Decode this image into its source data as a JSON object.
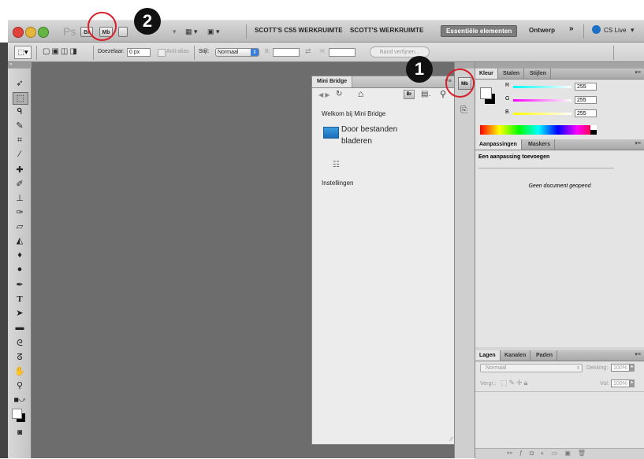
{
  "appbar": {
    "ps": "Ps",
    "br": "Br",
    "mb": "Mb",
    "workspace1": "SCOTT'S CS5 WERKRUIMTE",
    "workspace2": "SCOTT'S WERKRUIMTE",
    "workspace_active": "Essentiële elementen",
    "workspace3": "Ontwerp",
    "more": "»",
    "cslive": "CS Live"
  },
  "options": {
    "feather_label": "Doezelaar:",
    "feather_value": "0 px",
    "antialias": "Anti-alias",
    "style_label": "Stijl:",
    "style_value": "Normaal",
    "w_label": "B:",
    "h_label": "H:",
    "refine": "Rand verfijnen..."
  },
  "minibridge": {
    "tab": "Mini Bridge",
    "br": "Br",
    "welcome": "Welkom bij Mini Bridge",
    "browse_line1": "Door bestanden",
    "browse_line2": "bladeren",
    "settings": "Instellingen"
  },
  "dock": {
    "mb": "Mb"
  },
  "color_panel": {
    "tabs": [
      "Kleur",
      "Stalen",
      "Stijlen"
    ],
    "r_label": "R",
    "g_label": "G",
    "b_label": "B",
    "r": "255",
    "g": "255",
    "b": "255"
  },
  "adjust_panel": {
    "tabs": [
      "Aanpassingen",
      "Maskers"
    ],
    "add": "Een aanpassing toevoegen",
    "nodoc": "Geen document geopend"
  },
  "layers_panel": {
    "tabs": [
      "Lagen",
      "Kanalen",
      "Paden"
    ],
    "blend": "Normaal",
    "opacity_label": "Dekking:",
    "opacity": "100%",
    "lock_label": "Vergr.:",
    "fill_label": "Vul:",
    "fill": "100%"
  },
  "callouts": {
    "one": "1",
    "two": "2"
  },
  "colors": {
    "accent_ring": "#d61f2a",
    "canvas": "#6d6d6d"
  }
}
